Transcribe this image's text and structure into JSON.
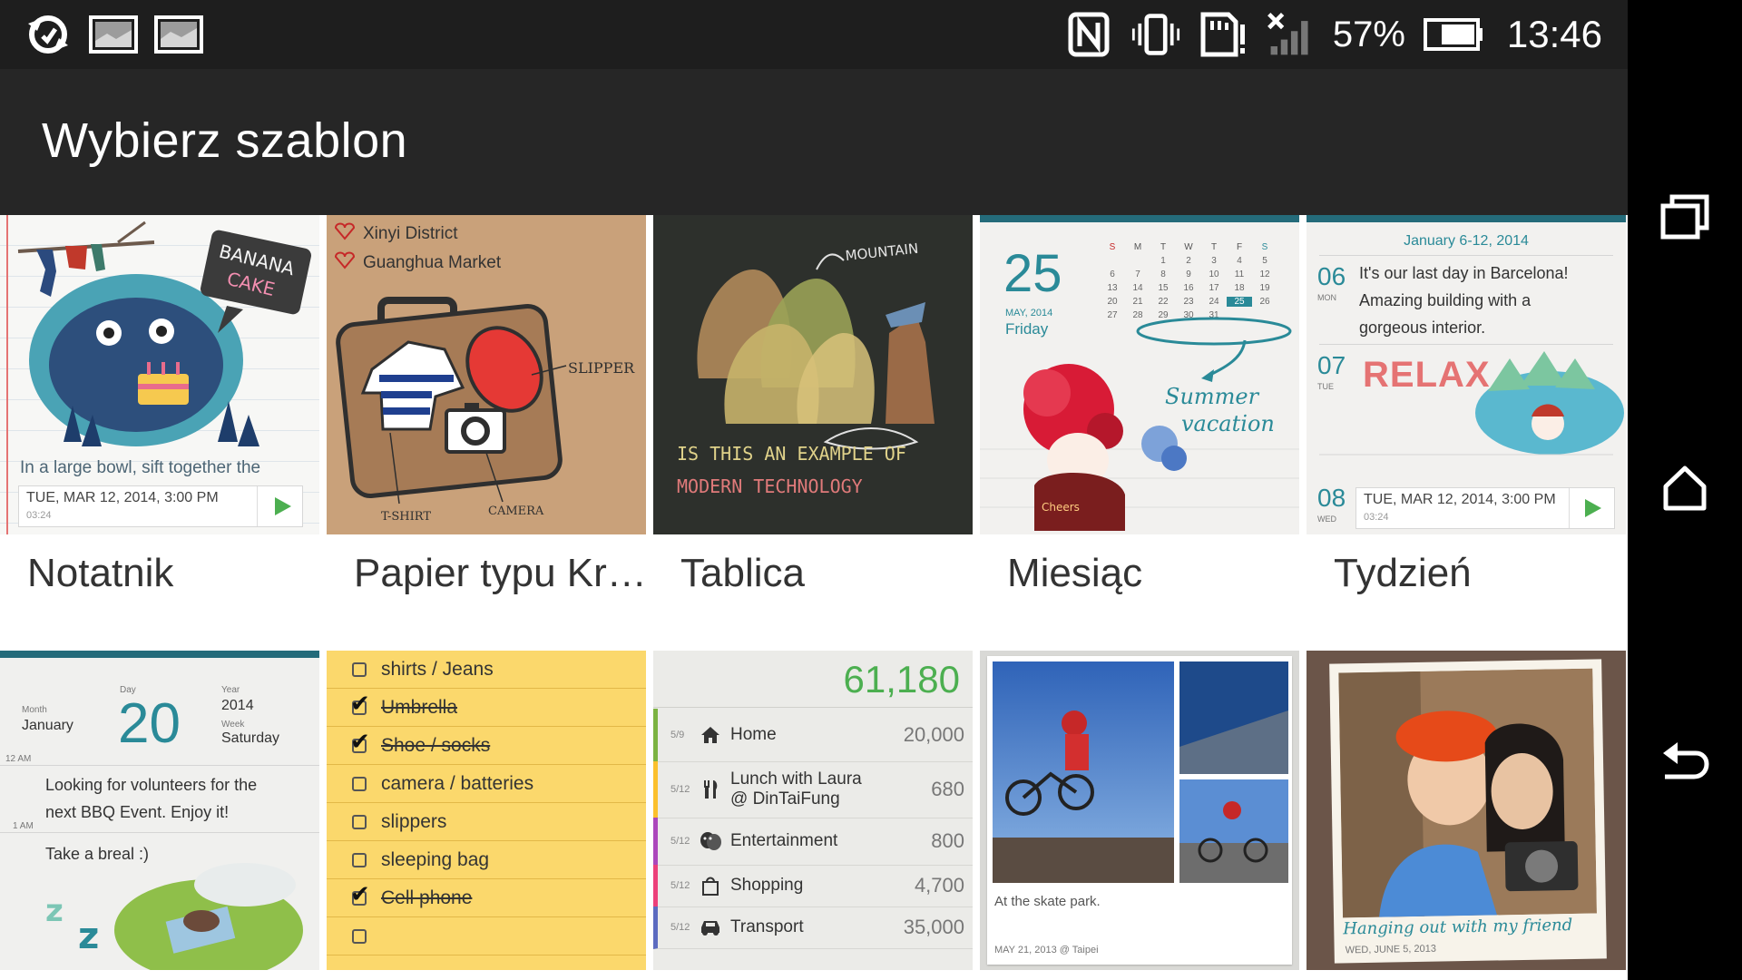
{
  "status_bar": {
    "battery_percent": "57%",
    "time": "13:46"
  },
  "app_bar": {
    "title": "Wybierz szablon"
  },
  "templates": [
    {
      "label": "Notatnik"
    },
    {
      "label": "Papier typu Kr…"
    },
    {
      "label": "Tablica"
    },
    {
      "label": "Miesiąc"
    },
    {
      "label": "Tydzień"
    }
  ],
  "notatnik_tile": {
    "sign_line1": "BANANA",
    "sign_line2": "CAKE",
    "note_text": "In a large bowl, sift together the",
    "entry_date": "TUE, MAR 12, 2014, 3:00 PM",
    "entry_duration": "03:24"
  },
  "kraft_tile": {
    "place1": "Xinyi District",
    "place2": "Guanghua Market",
    "label_slipper": "SLIPPER",
    "label_tshirt": "T-SHIRT",
    "label_camera": "CAMERA"
  },
  "tablica_tile": {
    "label_mountain": "MOUNTAIN",
    "line1": "IS THIS AN EXAMPLE OF",
    "line2": "MODERN TECHNOLOGY"
  },
  "miesiac_tile": {
    "day": "25",
    "month_year": "MAY, 2014",
    "weekday": "Friday",
    "week_header": [
      "S",
      "M",
      "T",
      "W",
      "T",
      "F",
      "S"
    ],
    "calendar_rows": [
      [
        "",
        "",
        "1",
        "2",
        "3",
        "4",
        "5"
      ],
      [
        "6",
        "7",
        "8",
        "9",
        "10",
        "11",
        "12"
      ],
      [
        "13",
        "14",
        "15",
        "16",
        "17",
        "18",
        "19"
      ],
      [
        "20",
        "21",
        "22",
        "23",
        "24",
        "25",
        "26"
      ],
      [
        "27",
        "28",
        "29",
        "30",
        "31",
        "",
        ""
      ]
    ],
    "note_line1": "Summer",
    "note_line2": "vacation",
    "badge": "Cheers"
  },
  "tydzien_tile": {
    "header": "January 6-12, 2014",
    "days": [
      {
        "num": "06",
        "name": "MON"
      },
      {
        "num": "07",
        "name": "TUE"
      },
      {
        "num": "08",
        "name": "WED"
      }
    ],
    "text_line1": "It's our last day in Barcelona!",
    "text_line2": "Amazing building with a",
    "text_line3": "gorgeous interior.",
    "relax": "RELAX",
    "entry_date": "TUE, MAR 12, 2014, 3:00 PM",
    "entry_duration": "03:24"
  },
  "day_tile": {
    "month_label": "Month",
    "month": "January",
    "day_label": "Day",
    "day": "20",
    "year_label": "Year",
    "year": "2014",
    "week_label": "Week",
    "weekday": "Saturday",
    "time1": "12 AM",
    "time2": "1 AM",
    "text1": "Looking for volunteers for the",
    "text2": "next BBQ Event. Enjoy it!",
    "text3": "Take a breal :)"
  },
  "list_tile": {
    "items": [
      {
        "text": "shirts / Jeans",
        "done": false
      },
      {
        "text": "Umbrella",
        "done": true
      },
      {
        "text": "Shoe / socks",
        "done": true
      },
      {
        "text": "camera / batteries",
        "done": false
      },
      {
        "text": "slippers",
        "done": false
      },
      {
        "text": "sleeping bag",
        "done": false
      },
      {
        "text": "Cell phone",
        "done": true
      },
      {
        "text": "",
        "done": false
      }
    ]
  },
  "expense_tile": {
    "total": "61,180",
    "rows": [
      {
        "date": "5/9",
        "icon": "home-icon",
        "label": "Home",
        "label2": "",
        "amount": "20,000",
        "color": "#7cb342"
      },
      {
        "date": "5/12",
        "icon": "fork-knife-icon",
        "label": "Lunch with Laura",
        "label2": "@ DinTaiFung",
        "amount": "680",
        "color": "#fbc02d"
      },
      {
        "date": "5/12",
        "icon": "theater-masks-icon",
        "label": "Entertainment",
        "label2": "",
        "amount": "800",
        "color": "#ab47bc"
      },
      {
        "date": "5/12",
        "icon": "shopping-bag-icon",
        "label": "Shopping",
        "label2": "",
        "amount": "4,700",
        "color": "#ec407a"
      },
      {
        "date": "5/12",
        "icon": "car-icon",
        "label": "Transport",
        "label2": "",
        "amount": "35,000",
        "color": "#5c6bc0"
      }
    ]
  },
  "photo_tile": {
    "caption": "At the skate park.",
    "meta": "MAY 21, 2013 @ Taipei"
  },
  "frame_tile": {
    "caption": "Hanging out with my friend",
    "meta": "WED, JUNE 5, 2013"
  },
  "colors": {
    "status_bar": "#1e1e1e",
    "app_bar": "#262626",
    "nav_bar": "#000000",
    "teal": "#2a8a98",
    "kraft": "#c9a17a",
    "list_yellow": "#fbd86c",
    "expense_green": "#4caf50"
  }
}
